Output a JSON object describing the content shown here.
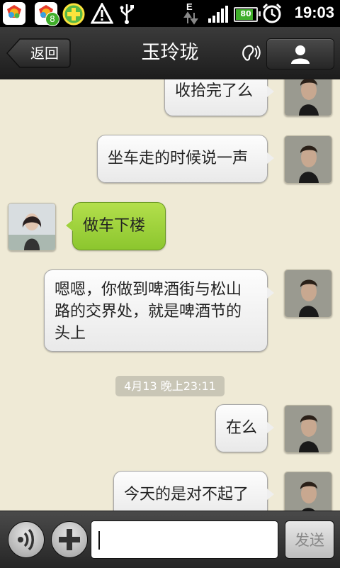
{
  "status_bar": {
    "time": "19:03",
    "battery_level": "80",
    "notification_badge": "8",
    "network_type": "E",
    "icons": [
      "app-icon",
      "app-icon-with-badge",
      "plus-app-icon",
      "warning-icon",
      "usb-icon",
      "data-arrows-icon",
      "signal-icon",
      "battery-icon",
      "alarm-icon"
    ]
  },
  "header": {
    "back_label": "返回",
    "title": "玉玲珑",
    "ear_icon": "earpiece-mode-icon",
    "profile_icon": "person-icon"
  },
  "messages": [
    {
      "side": "right",
      "text": "收拾完了么",
      "sender": "me"
    },
    {
      "side": "right",
      "text": "坐车走的时候说一声",
      "sender": "me"
    },
    {
      "side": "left",
      "text": "做车下楼",
      "sender": "contact"
    },
    {
      "side": "right",
      "text": "嗯嗯，你做到啤酒街与松山路的交界处，就是啤酒节的头上",
      "line1": "嗯嗯，你做到啤酒街与松山",
      "line2": "路的交界处，就是啤酒节的",
      "line3": "头上",
      "sender": "me"
    },
    {
      "side": "right",
      "text": "在么",
      "sender": "me"
    },
    {
      "side": "right",
      "text": "今天的是对不起了",
      "sender": "me"
    }
  ],
  "timestamp": "4月13 晚上23:11",
  "input_bar": {
    "voice_icon": "voice-icon",
    "plus_icon": "plus-icon",
    "input_value": "",
    "send_label": "发送"
  },
  "colors": {
    "chat_background": "#efead6",
    "incoming_bubble": "#9fd23c",
    "outgoing_bubble": "#f4f4f4",
    "title_bar": "#2a2a2a"
  }
}
